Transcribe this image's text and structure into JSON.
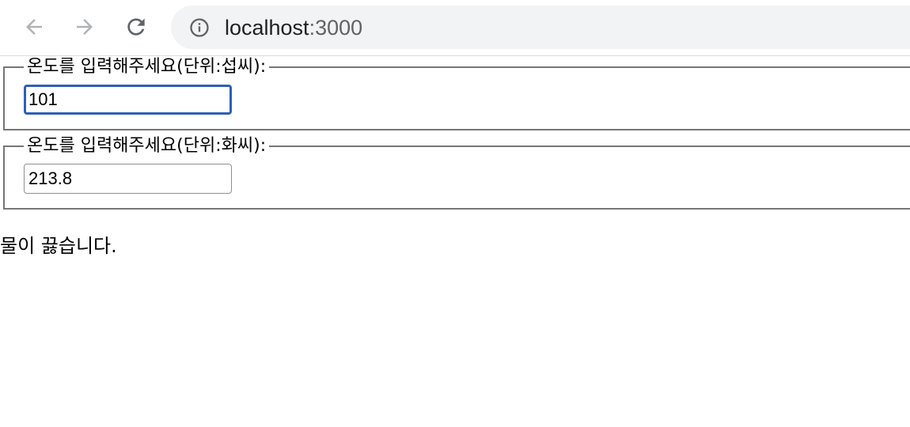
{
  "browser": {
    "url_host": "localhost",
    "url_port": ":3000",
    "icons": {
      "back": "arrow-left-icon",
      "forward": "arrow-right-icon",
      "reload": "reload-icon",
      "site_info": "info-icon"
    }
  },
  "form": {
    "celsius": {
      "legend": "온도를 입력해주세요(단위:섭씨):",
      "value": "101"
    },
    "fahrenheit": {
      "legend": "온도를 입력해주세요(단위:화씨):",
      "value": "213.8"
    }
  },
  "verdict": "물이 끓습니다.",
  "colors": {
    "focus_ring": "#2d5fb9",
    "fieldset_border": "#767676",
    "omnibox_bg": "#f1f3f4"
  }
}
